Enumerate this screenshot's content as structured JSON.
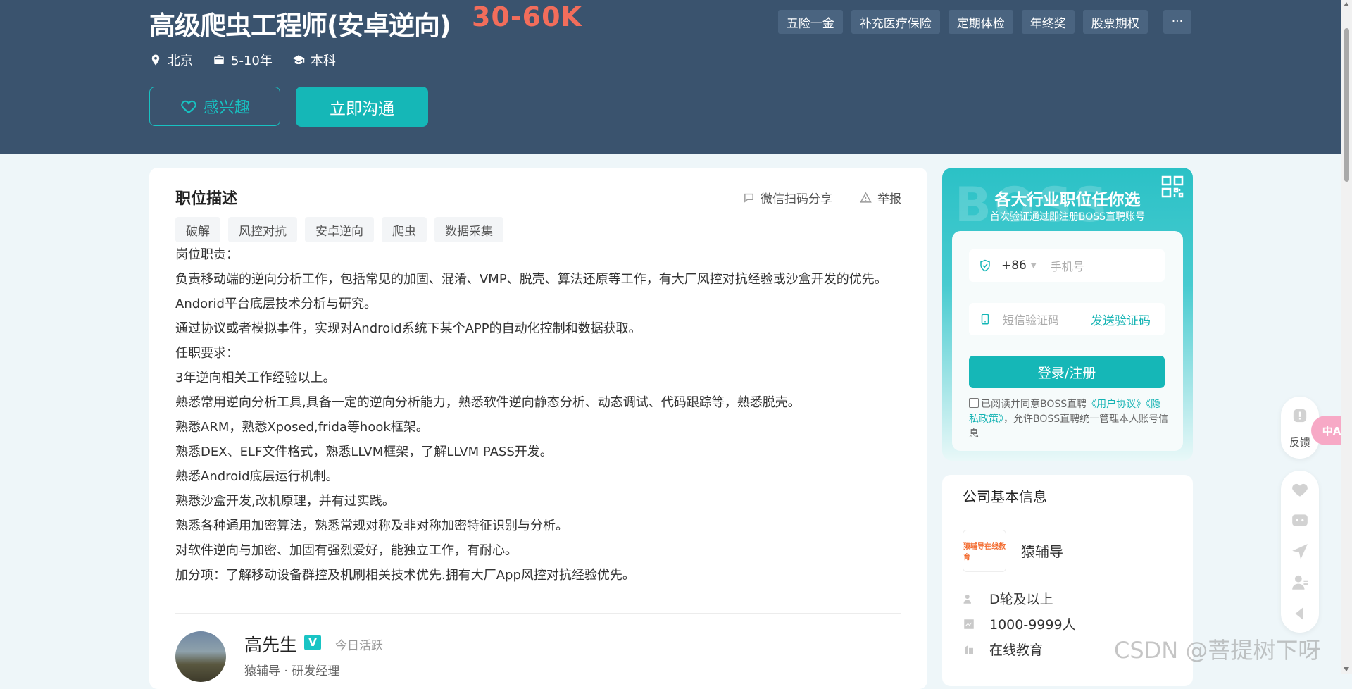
{
  "header": {
    "job_title": "高级爬虫工程师(安卓逆向)",
    "salary": "30-60K",
    "meta": {
      "location": "北京",
      "experience": "5-10年",
      "degree": "本科"
    },
    "interest_label": "感兴趣",
    "chat_label": "立即沟通",
    "benefits": [
      "五险一金",
      "补充医疗保险",
      "定期体检",
      "年终奖",
      "股票期权"
    ],
    "more_label": "···"
  },
  "job": {
    "section_title": "职位描述",
    "share_label": "微信扫码分享",
    "report_label": "举报",
    "tags": [
      "破解",
      "风控对抗",
      "安卓逆向",
      "爬虫",
      "数据采集"
    ],
    "description_lines": [
      "岗位职责：",
      "负责移动端的逆向分析工作，包括常见的加固、混淆、VMP、脱壳、算法还原等工作，有大厂风控对抗经验或沙盒开发的优先。",
      "Andorid平台底层技术分析与研究。",
      "通过协议或者模拟事件，实现对Android系统下某个APP的自动化控制和数据获取。",
      "任职要求：",
      "3年逆向相关工作经验以上。",
      "熟悉常用逆向分析工具,具备一定的逆向分析能力，熟悉软件逆向静态分析、动态调试、代码跟踪等，熟悉脱壳。",
      "熟悉ARM，熟悉Xposed,frida等hook框架。",
      "熟悉DEX、ELF文件格式，熟悉LLVM框架，了解LLVM PASS开发。",
      "熟悉Android底层运行机制。",
      "熟悉沙盒开发,改机原理，并有过实践。",
      "熟悉各种通用加密算法，熟悉常规对称及非对称加密特征识别与分析。",
      "对软件逆向与加密、加固有强烈爱好，能独立工作，有耐心。",
      "加分项：了解移动设备群控及机刷相关技术优先.拥有大厂App风控对抗经验优先。"
    ],
    "recruiter": {
      "name": "高先生",
      "badge": "V",
      "status": "今日活跃",
      "subtitle": "猿辅导 · 研发经理"
    }
  },
  "login": {
    "watermark": "BOSS",
    "title": "各大行业职位任你选",
    "subtitle": "首次验证通过即注册BOSS直聘账号",
    "country_code": "+86",
    "phone_placeholder": "手机号",
    "code_placeholder": "短信验证码",
    "send_code_label": "发送验证码",
    "submit_label": "登录/注册",
    "agree_prefix": "已阅读并同意BOSS直聘",
    "agree_link1": "《用户协议》",
    "agree_link2": "《隐私政策》",
    "agree_suffix": "，允许BOSS直聘统一管理本人账号信息"
  },
  "company": {
    "title": "公司基本信息",
    "logo_text": "猿辅导在线教育",
    "name": "猿辅导",
    "stage": "D轮及以上",
    "size": "1000-9999人",
    "industry": "在线教育"
  },
  "floating": {
    "feedback_label": "反馈",
    "translate_label": "中A"
  },
  "page_watermark": "CSDN @菩提树下呀",
  "colors": {
    "header_bg": "#3a536e",
    "accent": "#15b7b7",
    "salary": "#f26d5b"
  }
}
